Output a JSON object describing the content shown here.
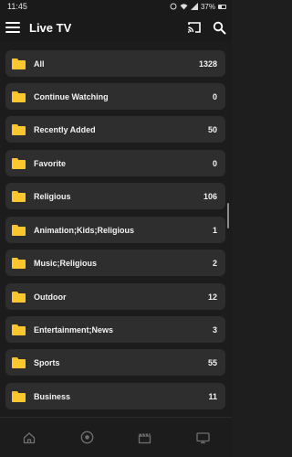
{
  "status_bar": {
    "time": "11:45",
    "battery": "37%"
  },
  "app_bar": {
    "title": "Live TV",
    "icons": [
      "menu-icon",
      "cast-icon",
      "search-icon"
    ]
  },
  "categories": [
    {
      "label": "All",
      "count": "1328"
    },
    {
      "label": "Continue Watching",
      "count": "0"
    },
    {
      "label": "Recently Added",
      "count": "50"
    },
    {
      "label": "Favorite",
      "count": "0"
    },
    {
      "label": "Religious",
      "count": "106"
    },
    {
      "label": "Animation;Kids;Religious",
      "count": "1"
    },
    {
      "label": "Music;Religious",
      "count": "2"
    },
    {
      "label": "Outdoor",
      "count": "12"
    },
    {
      "label": "Entertainment;News",
      "count": "3"
    },
    {
      "label": "Sports",
      "count": "55"
    },
    {
      "label": "Business",
      "count": "11"
    }
  ],
  "bottom_nav": [
    "home-icon",
    "sports-ball-icon",
    "movie-clapper-icon",
    "tv-icon"
  ],
  "colors": {
    "background": "#1e1e1e",
    "card": "#2e2e2e",
    "folder": "#fbc62e"
  }
}
